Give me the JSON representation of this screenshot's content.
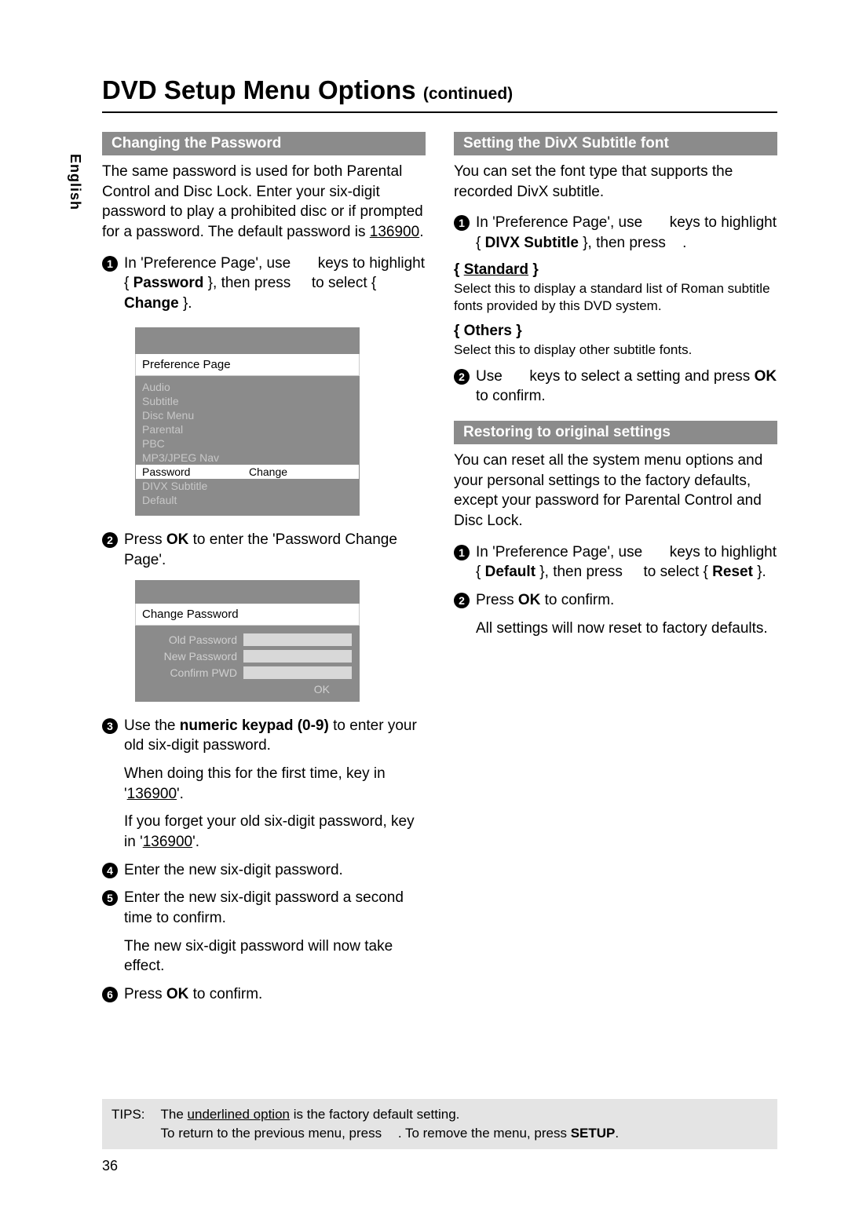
{
  "page": {
    "language_tab": "English",
    "title_main": "DVD Setup Menu Options",
    "title_cont": "(continued)",
    "number": "36"
  },
  "left": {
    "section": "Changing the Password",
    "intro": "The same password is used for both Parental Control and Disc Lock.  Enter your six-digit password to play a prohibited disc or if prompted for a password.  The default password is ",
    "default_pw": "136900",
    "step1a": "In 'Preference Page', use ",
    "step1b": " keys to highlight { ",
    "step1_bold": "Password",
    "step1c": " }, then press ",
    "step1d": " to select { ",
    "step1_bold2": "Change",
    "step1e": " }.",
    "ui": {
      "title": "Preference Page",
      "items": [
        "Audio",
        "Subtitle",
        "Disc Menu",
        "Parental",
        "PBC",
        "MP3/JPEG Nav",
        "Password",
        "DIVX Subtitle",
        "Default"
      ],
      "selected_value": "Change"
    },
    "step2a": "Press ",
    "step2_ok": "OK",
    "step2b": " to enter the 'Password Change Page'.",
    "pw_ui": {
      "title": "Change Password",
      "rows": [
        "Old Password",
        "New Password",
        "Confirm PWD"
      ],
      "ok": "OK"
    },
    "step3a": "Use the ",
    "step3_bold": "numeric keypad (0-9)",
    "step3b": " to enter your old six-digit password.",
    "step3_sub1a": "When doing this for the first time, key in '",
    "step3_sub1_pw": "136900",
    "step3_sub1b": "'.",
    "step3_sub2a": "If you forget your old six-digit password, key in '",
    "step3_sub2_pw": "136900",
    "step3_sub2b": "'.",
    "step4": "Enter the new six-digit password.",
    "step5": "Enter the new six-digit password a second time to confirm.",
    "step5_sub": "The new six-digit password will now take effect.",
    "step6a": "Press ",
    "step6_ok": "OK",
    "step6b": " to confirm."
  },
  "right": {
    "sec1": "Setting the DivX Subtitle font",
    "intro1": "You can set the font type that supports the recorded DivX subtitle.",
    "s1a": "In 'Preference Page', use ",
    "s1b": " keys to highlight { ",
    "s1_bold": "DIVX Subtitle",
    "s1c": " }, then press ",
    "s1d": ".",
    "opt1_label": "{ Standard }",
    "opt1_desc": "Select this to display a standard list of Roman subtitle fonts provided by this DVD system.",
    "opt2_label": "{ Others }",
    "opt2_desc": "Select this to display other subtitle fonts.",
    "s2a": "Use ",
    "s2b": " keys to select a setting and press ",
    "s2_ok": "OK",
    "s2c": " to confirm.",
    "sec2": "Restoring to original settings",
    "intro2": "You can reset all the system menu options and your personal settings to the factory defaults, except your password for Parental Control and Disc Lock.",
    "r1a": "In 'Preference Page', use ",
    "r1b": " keys to highlight { ",
    "r1_bold": "Default",
    "r1c": " }, then press ",
    "r1d": " to select { ",
    "r1_bold2": "Reset",
    "r1e": " }.",
    "r2a": "Press ",
    "r2_ok": "OK",
    "r2b": " to confirm.",
    "r2_sub": "All settings will now reset to factory defaults."
  },
  "tips": {
    "label": "TIPS:",
    "line1a": "The ",
    "line1_u": "underlined option",
    "line1b": " is the factory default setting.",
    "line2a": "To return to the previous menu, press ",
    "line2b": ".  To remove the menu, press ",
    "line2_bold": "SETUP",
    "line2c": "."
  }
}
